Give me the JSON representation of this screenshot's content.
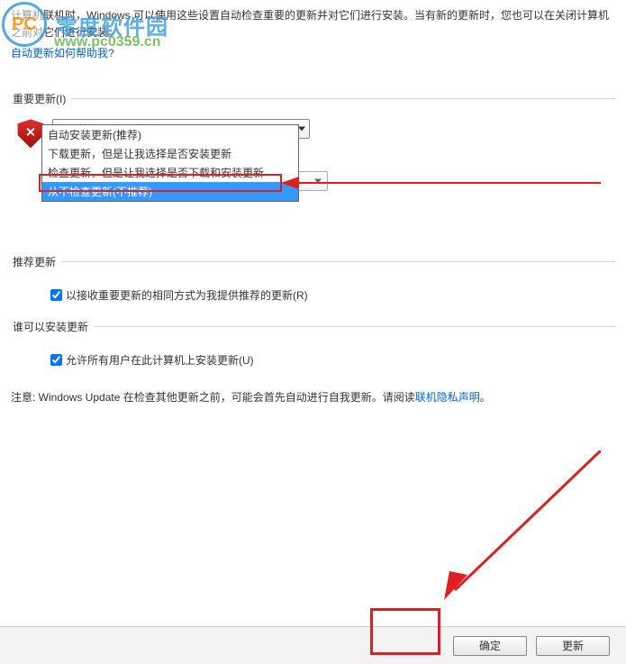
{
  "watermark": {
    "logo_text": "PC",
    "title": "零度软件园",
    "url": "www.pc0359.cn"
  },
  "intro": {
    "line": "计算机联机时，Windows 可以使用这些设置自动检查重要的更新并对它们进行安装。当有新的更新时，您也可以在关闭计算机之前对它们进行安装。",
    "help_link": "自动更新如何帮助我?"
  },
  "sections": {
    "important": {
      "legend": "重要更新(I)",
      "combo_selected": "从不检查更新(不推荐)",
      "options": {
        "o0": "自动安装更新(推荐)",
        "o1": "下载更新，但是让我选择是否安装更新",
        "o2": "检查更新，但是让我选择是否下载和安装更新",
        "o3": "从不检查更新(不推荐)"
      }
    },
    "recommended": {
      "legend": "推荐更新",
      "checkbox_label": "以接收重要更新的相同方式为我提供推荐的更新(R)"
    },
    "who": {
      "legend": "谁可以安装更新",
      "checkbox_label": "允许所有用户在此计算机上安装更新(U)"
    }
  },
  "note": {
    "prefix": "注意: Windows Update 在检查其他更新之前，可能会首先自动进行自我更新。请阅读",
    "link": "联机隐私声明",
    "suffix": "。"
  },
  "footer": {
    "ok": "确定",
    "update": "更新"
  }
}
